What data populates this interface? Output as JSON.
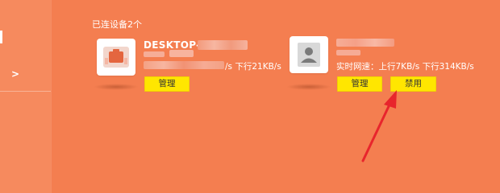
{
  "sidebar": {
    "chevron": ">"
  },
  "section_title": "已连设备2个",
  "devices": [
    {
      "name": "DESKTOP-GT",
      "speed_text": "/s  下行21KB/s",
      "manage_label": "管理"
    },
    {
      "name": "",
      "speed_text": "实时网速：上行7KB/s  下行314KB/s",
      "manage_label": "管理",
      "disable_label": "禁用"
    }
  ],
  "colors": {
    "background": "#f47e50",
    "sidebar": "#f68a5e",
    "button": "#ffe600",
    "arrow": "#e8252c"
  }
}
